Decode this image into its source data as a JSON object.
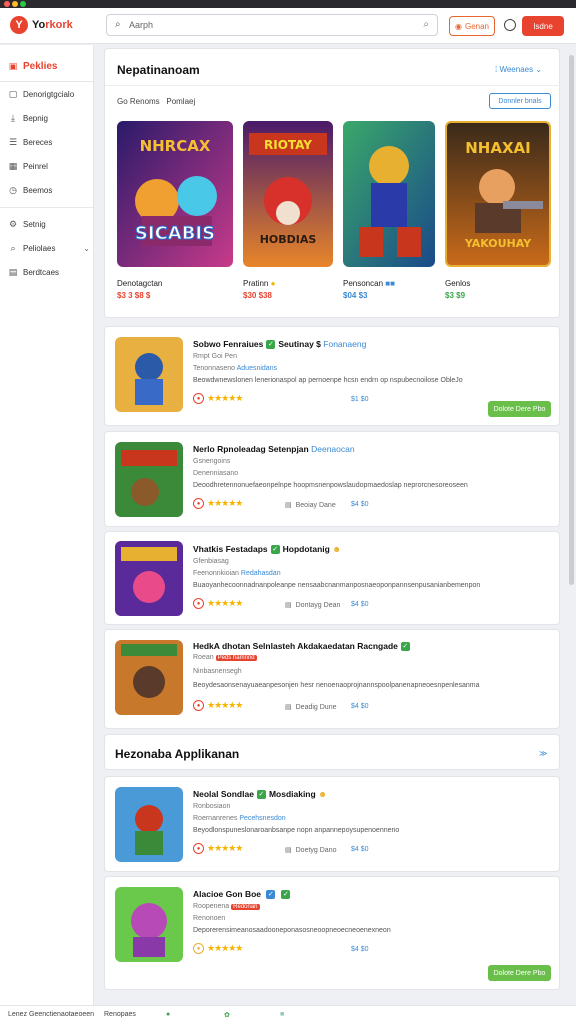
{
  "topbar": {
    "logo_mark": "Y",
    "logo_text": "Yo",
    "logo_text_accent": "rkork",
    "search_placeholder": "Aarph",
    "btn_outline": "Genan",
    "btn_red": "Isdne"
  },
  "sidebar": {
    "items": [
      {
        "label": "Peklies",
        "icon": "home-icon",
        "active": true
      },
      {
        "label": "Denorigtgcialo",
        "icon": "grid-icon"
      },
      {
        "label": "Bepnig",
        "icon": "download-icon"
      },
      {
        "label": "Bereces",
        "icon": "list-icon"
      },
      {
        "label": "Peinrel",
        "icon": "calendar-icon"
      },
      {
        "label": "Beemos",
        "icon": "clock-icon"
      },
      {
        "label": "Setnig",
        "icon": "settings-icon"
      },
      {
        "label": "Peliolaes",
        "icon": "search-icon",
        "chevron": "⌄"
      },
      {
        "label": "Berdtcaes",
        "icon": "chart-icon"
      }
    ]
  },
  "featured": {
    "title": "Nepatinanoam",
    "link": "Weenaes",
    "subtitle_left": "Go Renoms",
    "subtitle_right": "Pomlaej",
    "button": "Donnler bnals",
    "tiles": [
      {
        "name": "Denotagctan",
        "price": "$3 3 $8 $",
        "art_top": "NHRCAX",
        "art_bottom": "SICABIS",
        "color": "#4a2aa8"
      },
      {
        "name": "Pratinn",
        "price": "$30 $38",
        "art_top": "RIOTAY",
        "art_bottom": "HOBDIAS",
        "color": "#c8361e"
      },
      {
        "name": "Pensoncan",
        "price": "$04 $3",
        "art_top": "",
        "art_bottom": "",
        "color": "#2a6a3a"
      },
      {
        "name": "Genlos",
        "price": "$3 $9",
        "art_top": "NHAXAI",
        "art_bottom": "YAKOUHAY",
        "color": "#7a4a1a"
      }
    ]
  },
  "list_top": [
    {
      "title": "Sobwo Fenraiues",
      "title2": "Seutinay $",
      "tag": "Fonanaeng",
      "meta": "Rmpt Goi Pen",
      "meta_blue": "Aduesnidans",
      "meta2": "Tenonnaseno",
      "desc": "Beowdwnewslonen lenerionaspol ap pernoenpe hcsn endrn op nspubecnoilose ObleJo",
      "action": "",
      "count": "$1 $0",
      "green_btn": "Dolote Dere Pbo",
      "color": "#2a5aa8"
    },
    {
      "title": "Nerlo Rpnoleadag",
      "title2": "Setenpjan",
      "tag": "Deenaocan",
      "meta": "Gsnengoins",
      "meta_blue": "",
      "meta2": "Denenniasano",
      "desc": "Deoodhretennonuefaeonpelnpe hoopmsnenpowslaudopmaedoslap neprorcnesoreoseen",
      "action": "Beoiay Dane",
      "count": "$4 $0",
      "green_btn": "",
      "color": "#8a3a1a"
    },
    {
      "title": "Vhatkis Festadaps",
      "title2": "Hopdotanig",
      "tag": "",
      "meta": "Gfenbiasag",
      "meta_blue": "Redahasdan",
      "meta2": "Feenonnkioian",
      "desc": "Buaoyanhecoonnadnanpoleanpe nensaabcnanmanposnaeoponpannsenpusanianbemenpon",
      "action": "Dontayg Dean",
      "count": "$4 $0",
      "green_btn": "",
      "color": "#6a2a9a"
    },
    {
      "title": "HedkA dhotan Selnlasteh Akdakaedatan",
      "title2": "Racngade",
      "tag": "",
      "meta": "Roean",
      "meta_blue": "Peds hamnnd",
      "meta2": "Ninbasnensegh",
      "desc": "Beoydesaonsenayuaeanpesonjen hesr nenoenaoprojnannspoolpanenapneoesnpenlesanma",
      "action": "Deadig Dune",
      "count": "$4 $0",
      "green_btn": "",
      "color": "#7a5a1a"
    }
  ],
  "section2": {
    "title": "Hezonaba Applikanan",
    "link": "≫"
  },
  "list_bottom": [
    {
      "title": "Neolal Sondlae",
      "title2": "Mosdiaking",
      "tag": "",
      "meta": "Ronbosiaon",
      "meta_blue": "Pecehsnesdon",
      "meta2": "Roernanrenes",
      "desc": "Beyodlonspuneslonaroanbsanpe nopn anpannepoysupenoenneno",
      "action": "Doetyg Dano",
      "count": "$4 $0",
      "green_btn": "",
      "color": "#c8361e"
    },
    {
      "title": "Alacioe Gon Boe",
      "title2": "",
      "tag": "",
      "meta": "Roopenena",
      "meta_blue": "Redonan",
      "meta2": "Renonoen",
      "desc": "Deporerensimeanosaadooneponasosneoopneoecneoenexneon",
      "action": "",
      "count": "$4 $0",
      "green_btn": "Dolote Dere Pbo",
      "color": "#8a3aa8"
    }
  ],
  "bottombar": {
    "left": "Lenez Geenctienaotaeoeen",
    "mid": "Renopaes"
  }
}
